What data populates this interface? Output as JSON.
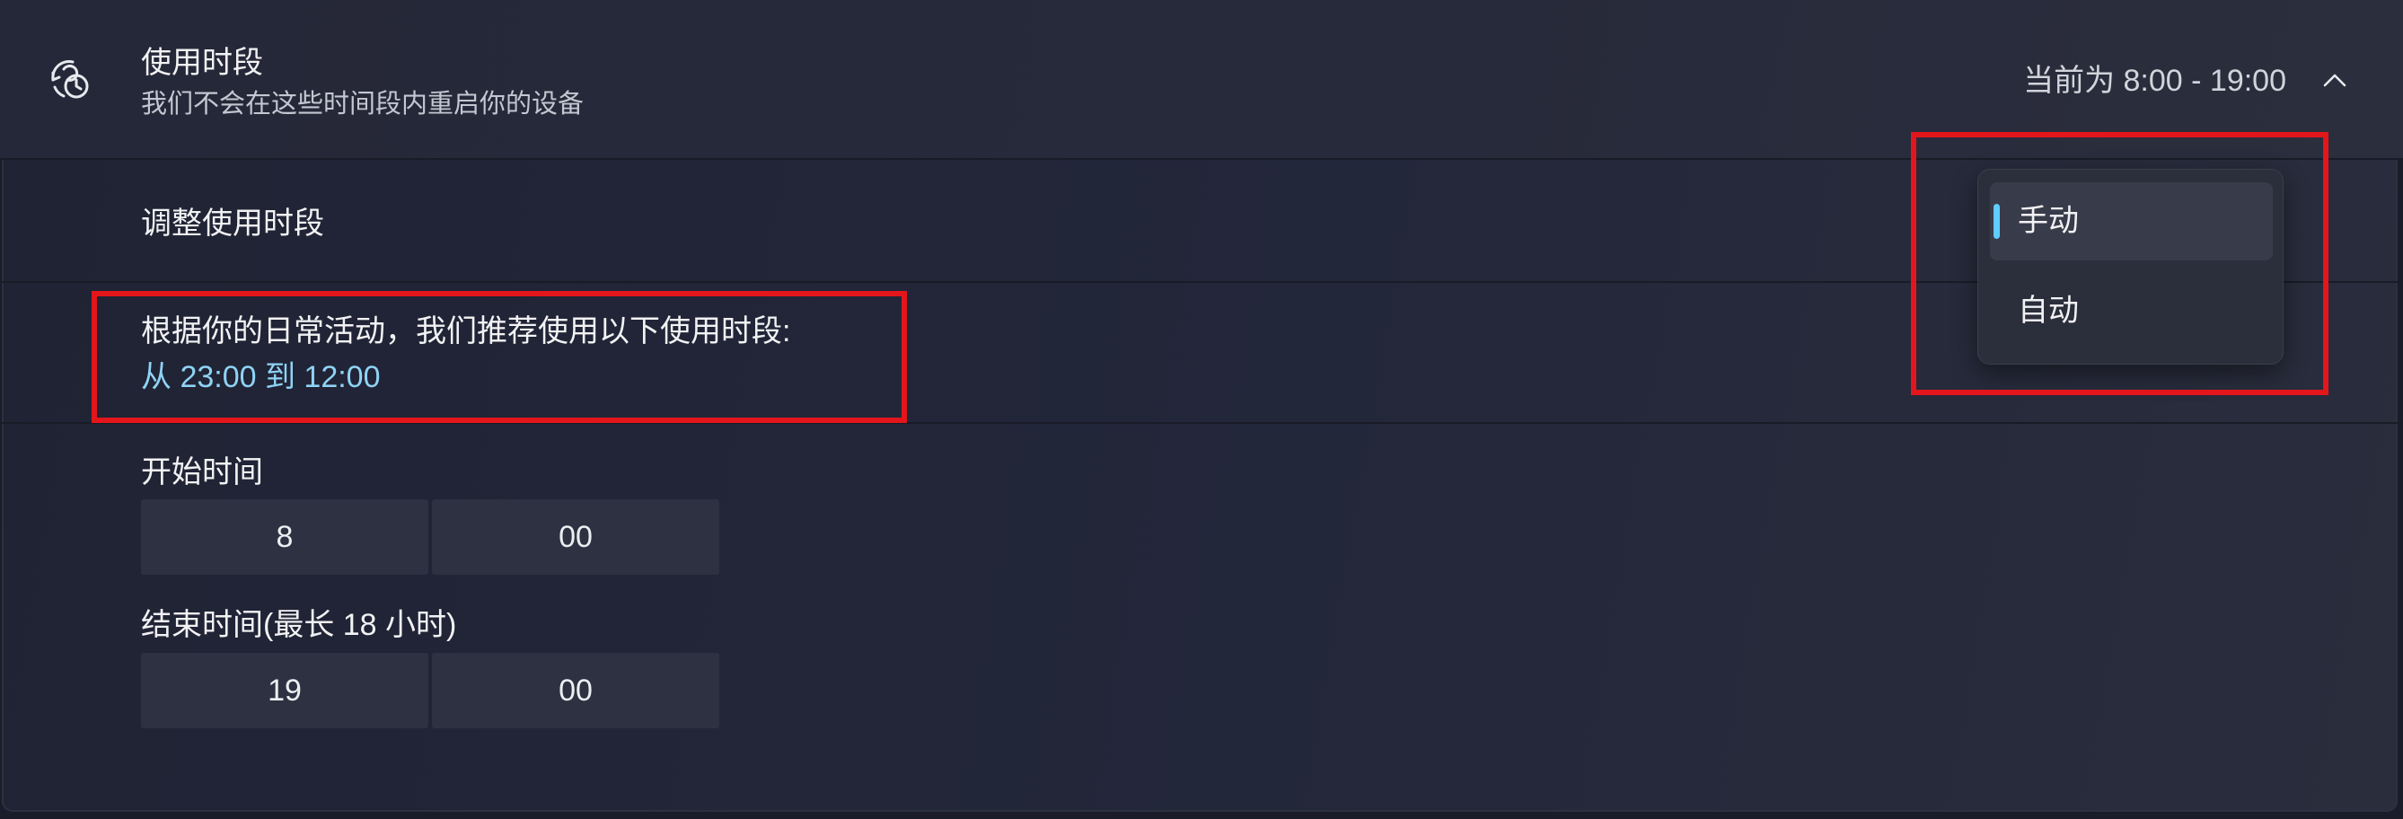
{
  "header": {
    "icon": "clock-refresh-icon",
    "title": "使用时段",
    "subtitle": "我们不会在这些时间段内重启你的设备",
    "current_label": "当前为 8:00 - 19:00",
    "expand_icon": "chevron-up-icon"
  },
  "adjust_row": {
    "label": "调整使用时段"
  },
  "dropdown": {
    "selected": "手动",
    "options": [
      {
        "label": "手动"
      },
      {
        "label": "自动"
      }
    ]
  },
  "recommendation": {
    "text": "根据你的日常活动，我们推荐使用以下使用时段:",
    "range": "从 23:00 到 12:00"
  },
  "start_time": {
    "label": "开始时间",
    "hour": "8",
    "minute": "00"
  },
  "end_time": {
    "label": "结束时间(最长 18 小时)",
    "hour": "19",
    "minute": "00"
  },
  "colors": {
    "accent": "#60cdff",
    "link_text": "#8fd3f5",
    "annotation_red": "#e3161b",
    "background": "#202334"
  }
}
